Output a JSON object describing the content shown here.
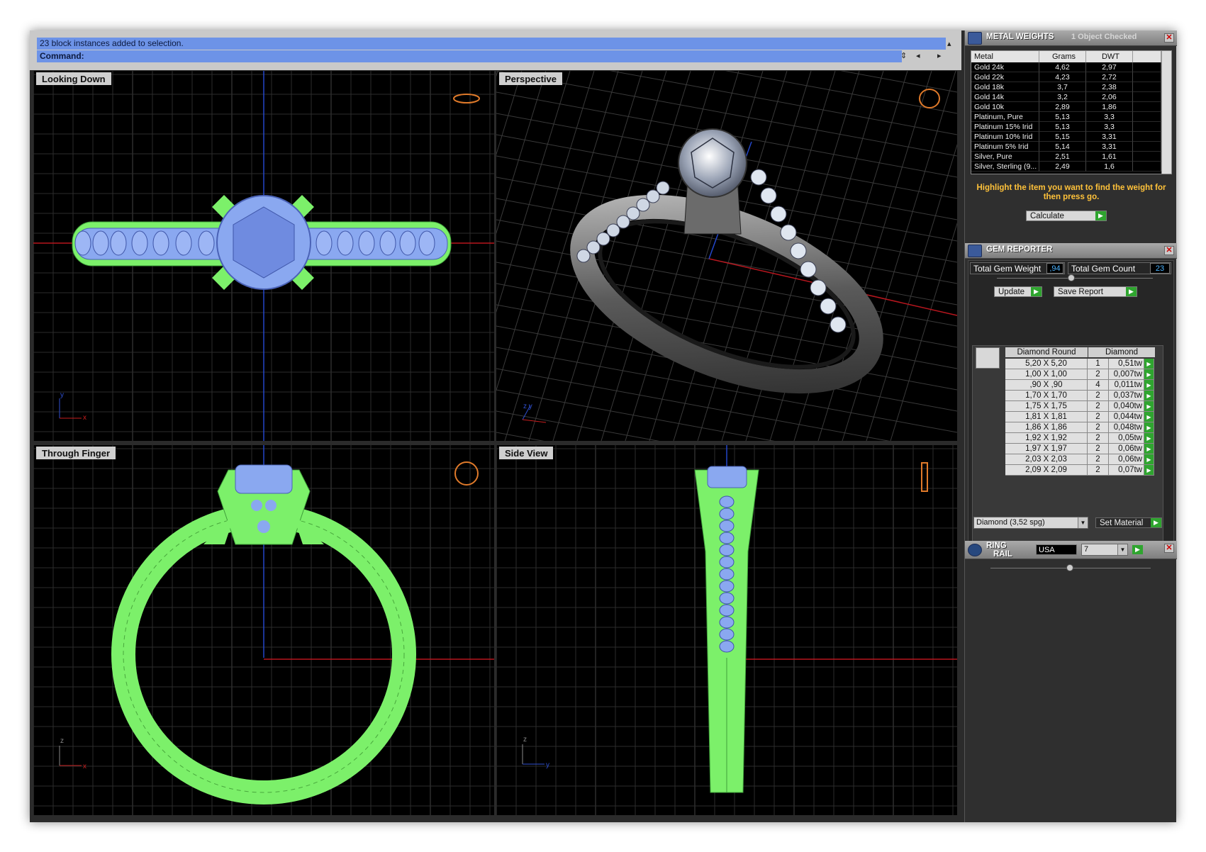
{
  "command": {
    "status": "23 block instances added to selection.",
    "prompt": "Command:"
  },
  "viewports": {
    "top": "Looking Down",
    "perspective": "Perspective",
    "front": "Through Finger",
    "side": "Side View"
  },
  "metal_weights": {
    "title": "METAL WEIGHTS",
    "subtitle": "1 Object Checked",
    "columns": [
      "Metal",
      "Grams",
      "DWT"
    ],
    "rows": [
      [
        "Gold 24k",
        "4,62",
        "2,97"
      ],
      [
        "Gold 22k",
        "4,23",
        "2,72"
      ],
      [
        "Gold 18k",
        "3,7",
        "2,38"
      ],
      [
        "Gold 14k",
        "3,2",
        "2,06"
      ],
      [
        "Gold 10k",
        "2,89",
        "1,86"
      ],
      [
        "Platinum, Pure",
        "5,13",
        "3,3"
      ],
      [
        "Platinum 15% Irid",
        "5,13",
        "3,3"
      ],
      [
        "Platinum 10% Irid",
        "5,15",
        "3,31"
      ],
      [
        "Platinum 5% Irid",
        "5,14",
        "3,31"
      ],
      [
        "Silver, Pure",
        "2,51",
        "1,61"
      ],
      [
        "Silver, Sterling (9...",
        "2,49",
        "1,6"
      ]
    ],
    "note": "Highlight the item you want to find the weight for then press go.",
    "calculate_label": "Calculate"
  },
  "gem_reporter": {
    "title": "GEM REPORTER",
    "total_weight_label": "Total Gem Weight",
    "total_weight": ",94",
    "total_count_label": "Total Gem Count",
    "total_count": "23",
    "update_label": "Update",
    "save_label": "Save Report",
    "col_shape": "Diamond Round",
    "col_material": "Diamond",
    "rows": [
      [
        "5,20 X 5,20",
        "1",
        "0,51tw"
      ],
      [
        "1,00 X 1,00",
        "2",
        "0,007tw"
      ],
      [
        ",90 X ,90",
        "4",
        "0,011tw"
      ],
      [
        "1,70 X 1,70",
        "2",
        "0,037tw"
      ],
      [
        "1,75 X 1,75",
        "2",
        "0,040tw"
      ],
      [
        "1,81 X 1,81",
        "2",
        "0,044tw"
      ],
      [
        "1,86 X 1,86",
        "2",
        "0,048tw"
      ],
      [
        "1,92 X 1,92",
        "2",
        "0,05tw"
      ],
      [
        "1,97 X 1,97",
        "2",
        "0,06tw"
      ],
      [
        "2,03 X 2,03",
        "2",
        "0,06tw"
      ],
      [
        "2,09 X 2,09",
        "2",
        "0,07tw"
      ]
    ],
    "material_select": "Diamond    (3,52 spg)",
    "set_material_label": "Set Material"
  },
  "ring_rail": {
    "title_line1": "RING",
    "title_line2": "RAIL",
    "standard": "USA",
    "size": "7"
  },
  "colors": {
    "wire_green": "#7cf06a",
    "gem_blue": "#8aa8f0",
    "accent_orange": "#ffc23a",
    "command_blue": "#6d93e7"
  }
}
